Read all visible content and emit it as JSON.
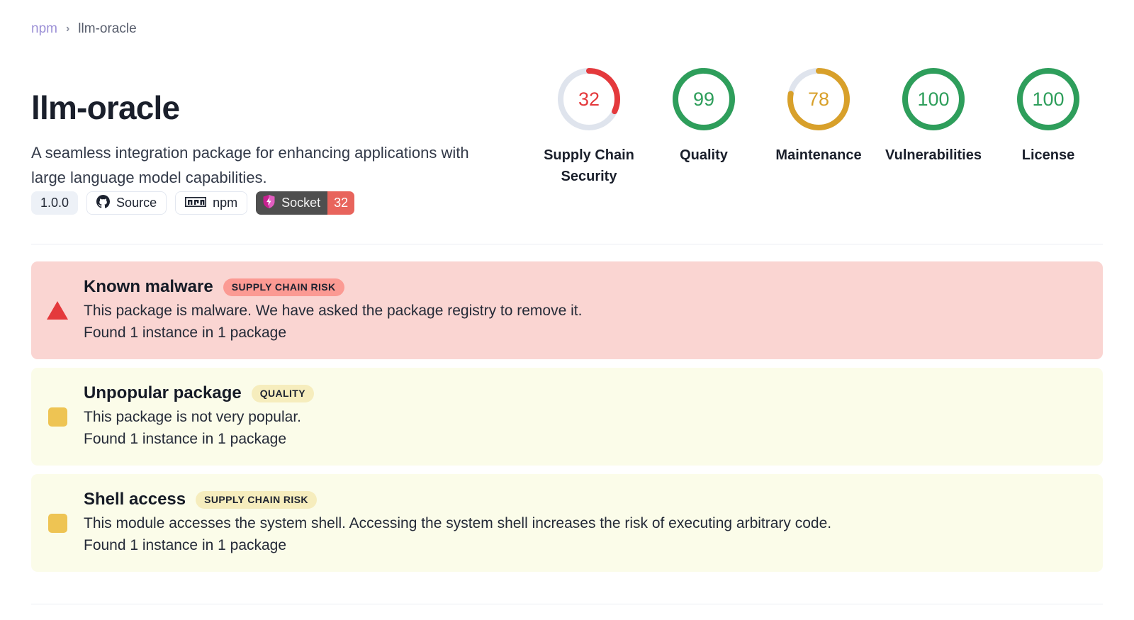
{
  "breadcrumb": {
    "registry": "npm",
    "separator": "›",
    "current": "llm-oracle"
  },
  "package": {
    "name": "llm-oracle",
    "description": "A seamless integration package for enhancing applications with large language model capabilities."
  },
  "pills": {
    "version": "1.0.0",
    "source_label": "Source",
    "npm_label": "npm",
    "socket_label": "Socket",
    "socket_score": "32"
  },
  "colors": {
    "accent_purple": "#9b8fd6",
    "danger_red": "#e4393c",
    "warn_amber": "#d8a02a",
    "good_green": "#2e9e5b",
    "ring_track": "#dfe4ed",
    "socket_dark": "#4f4f4f",
    "socket_red": "#e8645c",
    "card_danger_bg": "#fad5d2",
    "card_warn_bg": "#fbfce9",
    "tag_red_bg": "#fb9a93",
    "tag_yellow_bg": "#f6edbd"
  },
  "scores": [
    {
      "value": "32",
      "pct": 32,
      "label": "Supply Chain Security",
      "color": "#e4393c",
      "name": "supply-chain-security"
    },
    {
      "value": "99",
      "pct": 99,
      "label": "Quality",
      "color": "#2e9e5b",
      "name": "quality"
    },
    {
      "value": "78",
      "pct": 78,
      "label": "Maintenance",
      "color": "#d8a02a",
      "name": "maintenance"
    },
    {
      "value": "100",
      "pct": 100,
      "label": "Vulnerabilities",
      "color": "#2e9e5b",
      "name": "vulnerabilities"
    },
    {
      "value": "100",
      "pct": 100,
      "label": "License",
      "color": "#2e9e5b",
      "name": "license"
    }
  ],
  "alerts": [
    {
      "title": "Known malware",
      "tag": "SUPPLY CHAIN RISK",
      "description": "This package is malware. We have asked the package registry to remove it.",
      "found": "Found 1 instance in 1 package",
      "severity": "danger",
      "icon": "warning-triangle-icon"
    },
    {
      "title": "Unpopular package",
      "tag": "QUALITY",
      "description": "This package is not very popular.",
      "found": "Found 1 instance in 1 package",
      "severity": "warn",
      "icon": "warning-square-icon"
    },
    {
      "title": "Shell access",
      "tag": "SUPPLY CHAIN RISK",
      "description": "This module accesses the system shell. Accessing the system shell increases the risk of executing arbitrary code.",
      "found": "Found 1 instance in 1 package",
      "severity": "warn",
      "icon": "warning-square-icon"
    }
  ]
}
